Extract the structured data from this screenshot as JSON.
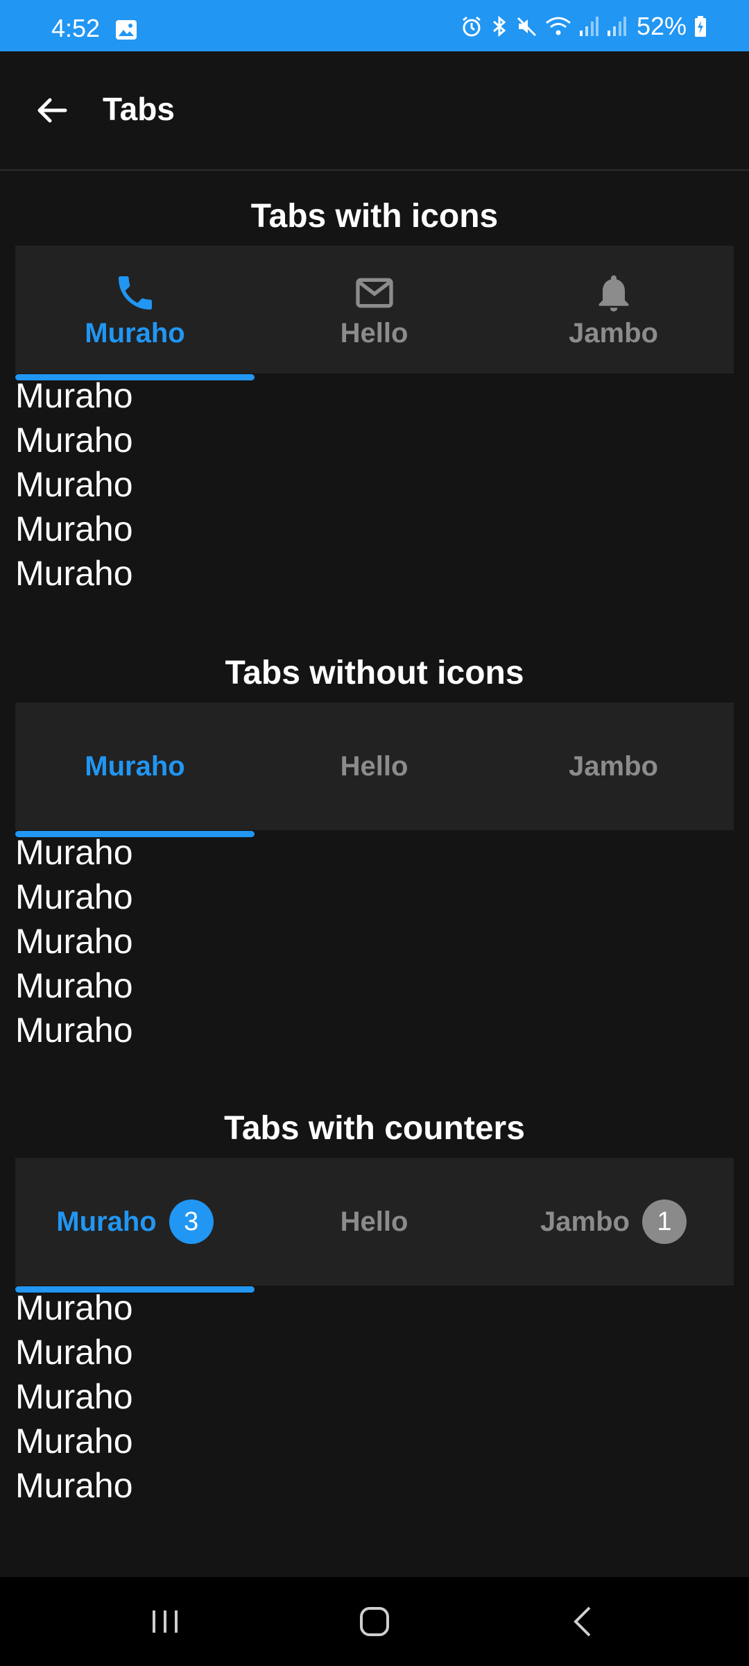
{
  "status_bar": {
    "time": "4:52",
    "battery": "52%",
    "icons": [
      "gallery-icon",
      "alarm-icon",
      "bluetooth-icon",
      "mute-icon",
      "wifi-icon",
      "signal-icon",
      "signal-icon",
      "battery-charging-icon"
    ]
  },
  "app_bar": {
    "title": "Tabs"
  },
  "sections": [
    {
      "title": "Tabs with icons",
      "tabs": [
        {
          "label": "Muraho",
          "icon": "phone-icon",
          "active": true
        },
        {
          "label": "Hello",
          "icon": "mail-icon",
          "active": false
        },
        {
          "label": "Jambo",
          "icon": "bell-icon",
          "active": false
        }
      ],
      "items": [
        "Muraho",
        "Muraho",
        "Muraho",
        "Muraho",
        "Muraho"
      ]
    },
    {
      "title": "Tabs without icons",
      "tabs": [
        {
          "label": "Muraho",
          "active": true
        },
        {
          "label": "Hello",
          "active": false
        },
        {
          "label": "Jambo",
          "active": false
        }
      ],
      "items": [
        "Muraho",
        "Muraho",
        "Muraho",
        "Muraho",
        "Muraho"
      ]
    },
    {
      "title": "Tabs with counters",
      "tabs": [
        {
          "label": "Muraho",
          "counter": "3",
          "active": true
        },
        {
          "label": "Hello",
          "active": false
        },
        {
          "label": "Jambo",
          "counter": "1",
          "active": false
        }
      ],
      "items": [
        "Muraho",
        "Muraho",
        "Muraho",
        "Muraho",
        "Muraho"
      ]
    }
  ],
  "colors": {
    "accent": "#2196f3",
    "background": "#141414",
    "tabbar": "#222222",
    "inactive": "#8c8c8c"
  }
}
